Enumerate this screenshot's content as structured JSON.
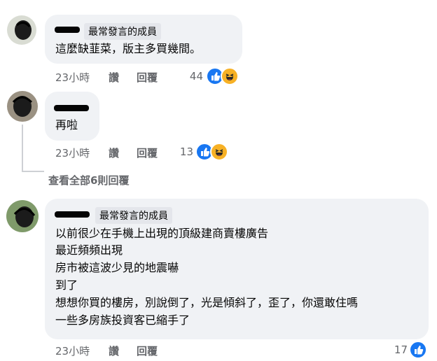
{
  "comments": [
    {
      "badge": "最常發言的成員",
      "lines": [
        "這麼缺韮菜，版主多買幾間。"
      ],
      "time": "23小時",
      "like": "讚",
      "reply": "回覆",
      "reaction_count": "44"
    },
    {
      "lines": [
        "再啦"
      ],
      "time": "23小時",
      "like": "讚",
      "reply": "回覆",
      "reaction_count": "13"
    },
    {
      "badge": "最常發言的成員",
      "lines": [
        "以前很少在手機上出現的頂級建商賣樓廣告",
        "最近頻頻出現",
        "房市被這波少見的地震嚇",
        "到了",
        "想想你買的樓房，別說倒了，光是傾斜了，歪了，你還敢住嗎",
        "一些多房族投資客已縮手了"
      ],
      "time": "23小時",
      "like": "讚",
      "reply": "回覆",
      "reaction_count": "17"
    }
  ],
  "view_all_replies": "查看全部6則回覆",
  "icons": {
    "like": "like-reaction-icon",
    "haha": "haha-reaction-icon"
  },
  "colors": {
    "like_blue": "#1877f2",
    "haha_yellow": "#f7b125",
    "bubble": "#f0f2f5",
    "meta_gray": "#65676b"
  }
}
